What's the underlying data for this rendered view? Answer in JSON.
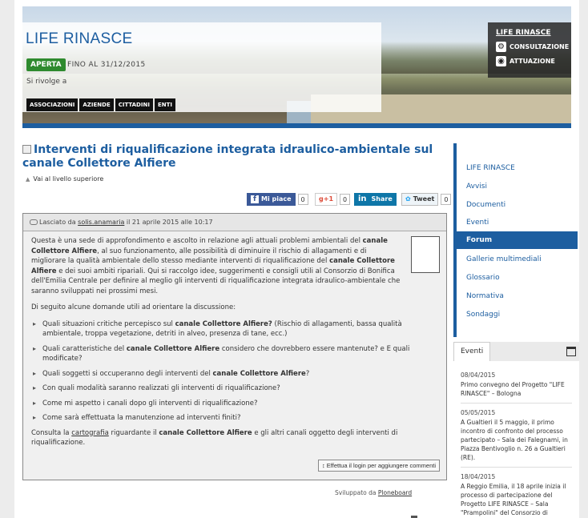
{
  "header": {
    "title": "LIFE RINASCE",
    "status_badge": "APERTA",
    "until_text": "FINO AL 31/12/2015",
    "target_label": "Si rivolge a",
    "tags": [
      "ASSOCIAZIONI",
      "AZIENDE",
      "CITTADINI",
      "ENTI"
    ],
    "right_box": {
      "title": "LIFE RINASCE",
      "items": [
        {
          "label": "CONSULTAZIONE",
          "icon": "gear-icon"
        },
        {
          "label": "ATTUAZIONE",
          "icon": "camera-icon"
        }
      ]
    }
  },
  "main": {
    "heading": "Interventi di riqualificazione integrata idraulico-ambientale sul canale Collettore Alfiere",
    "up_link": "Vai al livello superiore",
    "share": {
      "facebook_label": "Mi piace",
      "facebook_count": "0",
      "gplus_label": "+1",
      "gplus_count": "0",
      "linkedin_label": "Share",
      "tweet_label": "Tweet",
      "tweet_count": "0"
    },
    "post": {
      "posted_prefix": "Lasciato da",
      "author": "solis.anamaria",
      "posted_date": "il 21 aprile 2015 alle 10:17",
      "intro_parts": [
        "Questa è una sede di approfondimento e ascolto in relazione agli attuali problemi ambientali del ",
        "canale Collettore Alfiere",
        ", al suo funzionamento, alle possibilità di diminuire il rischio di allagamenti e di migliorare la qualità ambientale dello stesso mediante interventi di riqualificazione del ",
        "canale Collettore Alfiere",
        " e dei suoi ambiti ripariali. Qui si raccolgo idee, suggerimenti e consigli utili al Consorzio di Bonifica dell'Emilia Centrale per definire al meglio gli interventi di riqualificazione integrata idraulico-ambientale che saranno sviluppati nei prossimi mesi."
      ],
      "questions_intro": "Di seguito alcune domande utili ad orientare la discussione:",
      "questions": [
        {
          "a": "Quali situazioni critiche percepisco sul ",
          "b": "canale Collettore Alfiere?",
          "c": " (Rischio di allagamenti, bassa qualità ambientale, troppa vegetazione, detriti in alveo, presenza di tane, ecc.)"
        },
        {
          "a": "Quali caratteristiche del ",
          "b": "canale Collettore Alfiere",
          "c": " considero che dovrebbero essere mantenute? e E quali modificate?"
        },
        {
          "a": "Quali soggetti si occuperanno degli interventi del ",
          "b": "canale Collettore Alfiere",
          "c": "?"
        },
        {
          "a": "Con quali modalità saranno realizzati gli interventi di riqualificazione?",
          "b": "",
          "c": ""
        },
        {
          "a": "Come mi aspetto i canali dopo gli interventi di riqualificazione?",
          "b": "",
          "c": ""
        },
        {
          "a": "Come sarà effettuata la manutenzione ad interventi finiti?",
          "b": "",
          "c": ""
        }
      ],
      "outro_parts": [
        "Consulta la ",
        "cartografia",
        " riguardante il ",
        "canale Collettore Alfiere",
        " e gli altri canali oggetto degli interventi di riqualificazione."
      ],
      "login_button": "Effettua il login per aggiungere commenti"
    },
    "powered_prefix": "Sviluppato da",
    "powered_link": "Ploneboard"
  },
  "sidebar": {
    "nav": [
      {
        "label": "LIFE RINASCE",
        "active": false
      },
      {
        "label": "Avvisi",
        "active": false
      },
      {
        "label": "Documenti",
        "active": false
      },
      {
        "label": "Eventi",
        "active": false
      },
      {
        "label": "Forum",
        "active": true
      },
      {
        "label": "Gallerie multimediali",
        "active": false
      },
      {
        "label": "Glossario",
        "active": false
      },
      {
        "label": "Normativa",
        "active": false
      },
      {
        "label": "Sondaggi",
        "active": false
      }
    ],
    "events_title": "Eventi",
    "events": [
      {
        "date": "08/04/2015",
        "text": "Primo convegno del Progetto \"LIFE RINASCE\" – Bologna"
      },
      {
        "date": "05/05/2015",
        "text": "A Gualtieri il 5 maggio, il primo incontro di confronto del processo partecipato – Sala dei Falegnami, in Piazza Bentivoglio n. 26 a Gualtieri (RE)."
      },
      {
        "date": "18/04/2015",
        "text": "A Reggio Emilia, il 18 aprile inizia il processo di partecipazione del Progetto LIFE RINASCE – Sala \"Prampolini\" del Consorzio di"
      }
    ]
  },
  "colors": {
    "accent": "#1d5ea0",
    "status_green": "#2e8a2e",
    "facebook": "#3b5998",
    "gplus": "#dd4b39",
    "linkedin": "#0e76a8"
  }
}
